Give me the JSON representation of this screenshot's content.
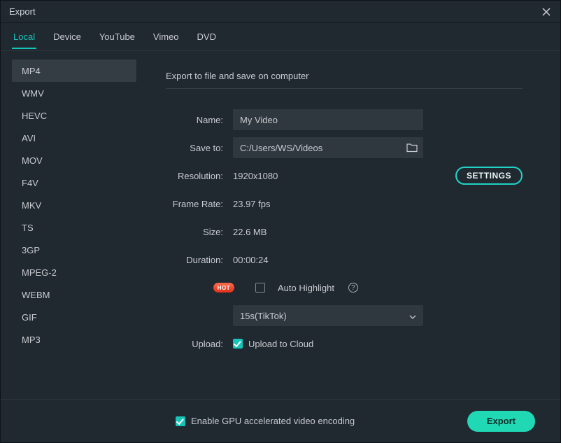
{
  "window": {
    "title": "Export"
  },
  "tabs": [
    "Local",
    "Device",
    "YouTube",
    "Vimeo",
    "DVD"
  ],
  "active_tab": "Local",
  "formats": [
    "MP4",
    "WMV",
    "HEVC",
    "AVI",
    "MOV",
    "F4V",
    "MKV",
    "TS",
    "3GP",
    "MPEG-2",
    "WEBM",
    "GIF",
    "MP3"
  ],
  "active_format": "MP4",
  "main": {
    "heading": "Export to file and save on computer",
    "name_label": "Name:",
    "name_value": "My Video",
    "saveto_label": "Save to:",
    "saveto_value": "C:/Users/WS/Videos",
    "resolution_label": "Resolution:",
    "resolution_value": "1920x1080",
    "settings_button": "SETTINGS",
    "framerate_label": "Frame Rate:",
    "framerate_value": "23.97 fps",
    "size_label": "Size:",
    "size_value": "22.6 MB",
    "duration_label": "Duration:",
    "duration_value": "00:00:24",
    "hot_badge": "HOT",
    "auto_highlight_label": "Auto Highlight",
    "auto_highlight_checked": false,
    "preset_select_value": "15s(TikTok)",
    "upload_label": "Upload:",
    "upload_cloud_label": "Upload to Cloud",
    "upload_cloud_checked": true
  },
  "footer": {
    "gpu_label": "Enable GPU accelerated video encoding",
    "gpu_checked": true,
    "export_button": "Export"
  }
}
